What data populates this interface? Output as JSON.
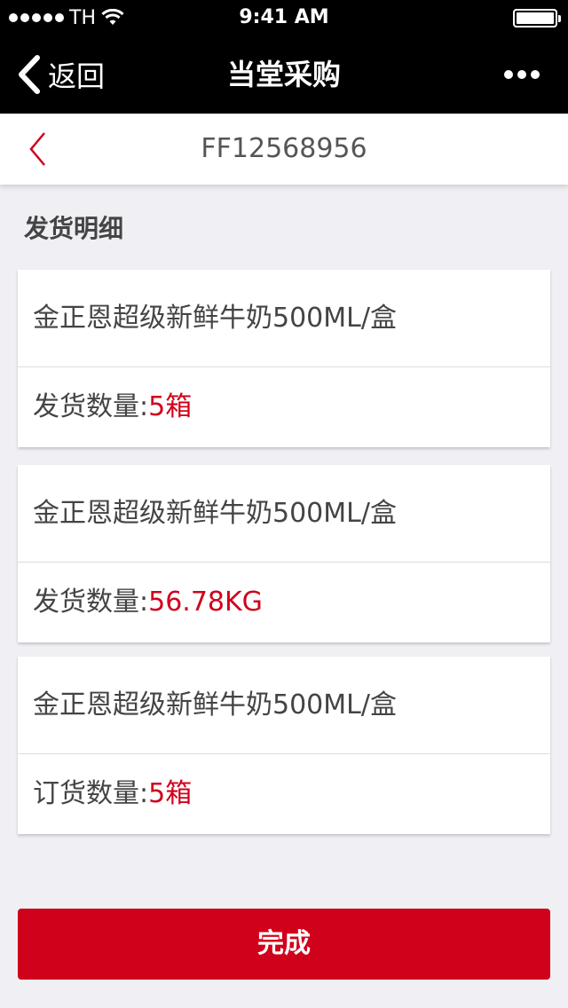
{
  "status_bar": {
    "carrier": "TH",
    "time": "9:41 AM",
    "battery_level": 1.0,
    "icons": [
      "signal-dots-icon",
      "wifi-icon",
      "battery-icon"
    ]
  },
  "nav": {
    "back_label": "返回",
    "title": "当堂采购",
    "icons": [
      "chevron-left-icon",
      "more-icon"
    ]
  },
  "order": {
    "number": "FF12568956",
    "back_icon": "chevron-left-icon",
    "accent_color": "#d0021b"
  },
  "section": {
    "title": "发货明细"
  },
  "items": [
    {
      "name": "金正恩超级新鲜牛奶500ML/盒",
      "qty_label": "发货数量:",
      "qty_value": "5箱"
    },
    {
      "name": "金正恩超级新鲜牛奶500ML/盒",
      "qty_label": "发货数量:",
      "qty_value": "56.78KG"
    },
    {
      "name": "金正恩超级新鲜牛奶500ML/盒",
      "qty_label": "订货数量:",
      "qty_value": "5箱"
    }
  ],
  "footer": {
    "done_label": "完成",
    "button_color": "#d0021b"
  }
}
